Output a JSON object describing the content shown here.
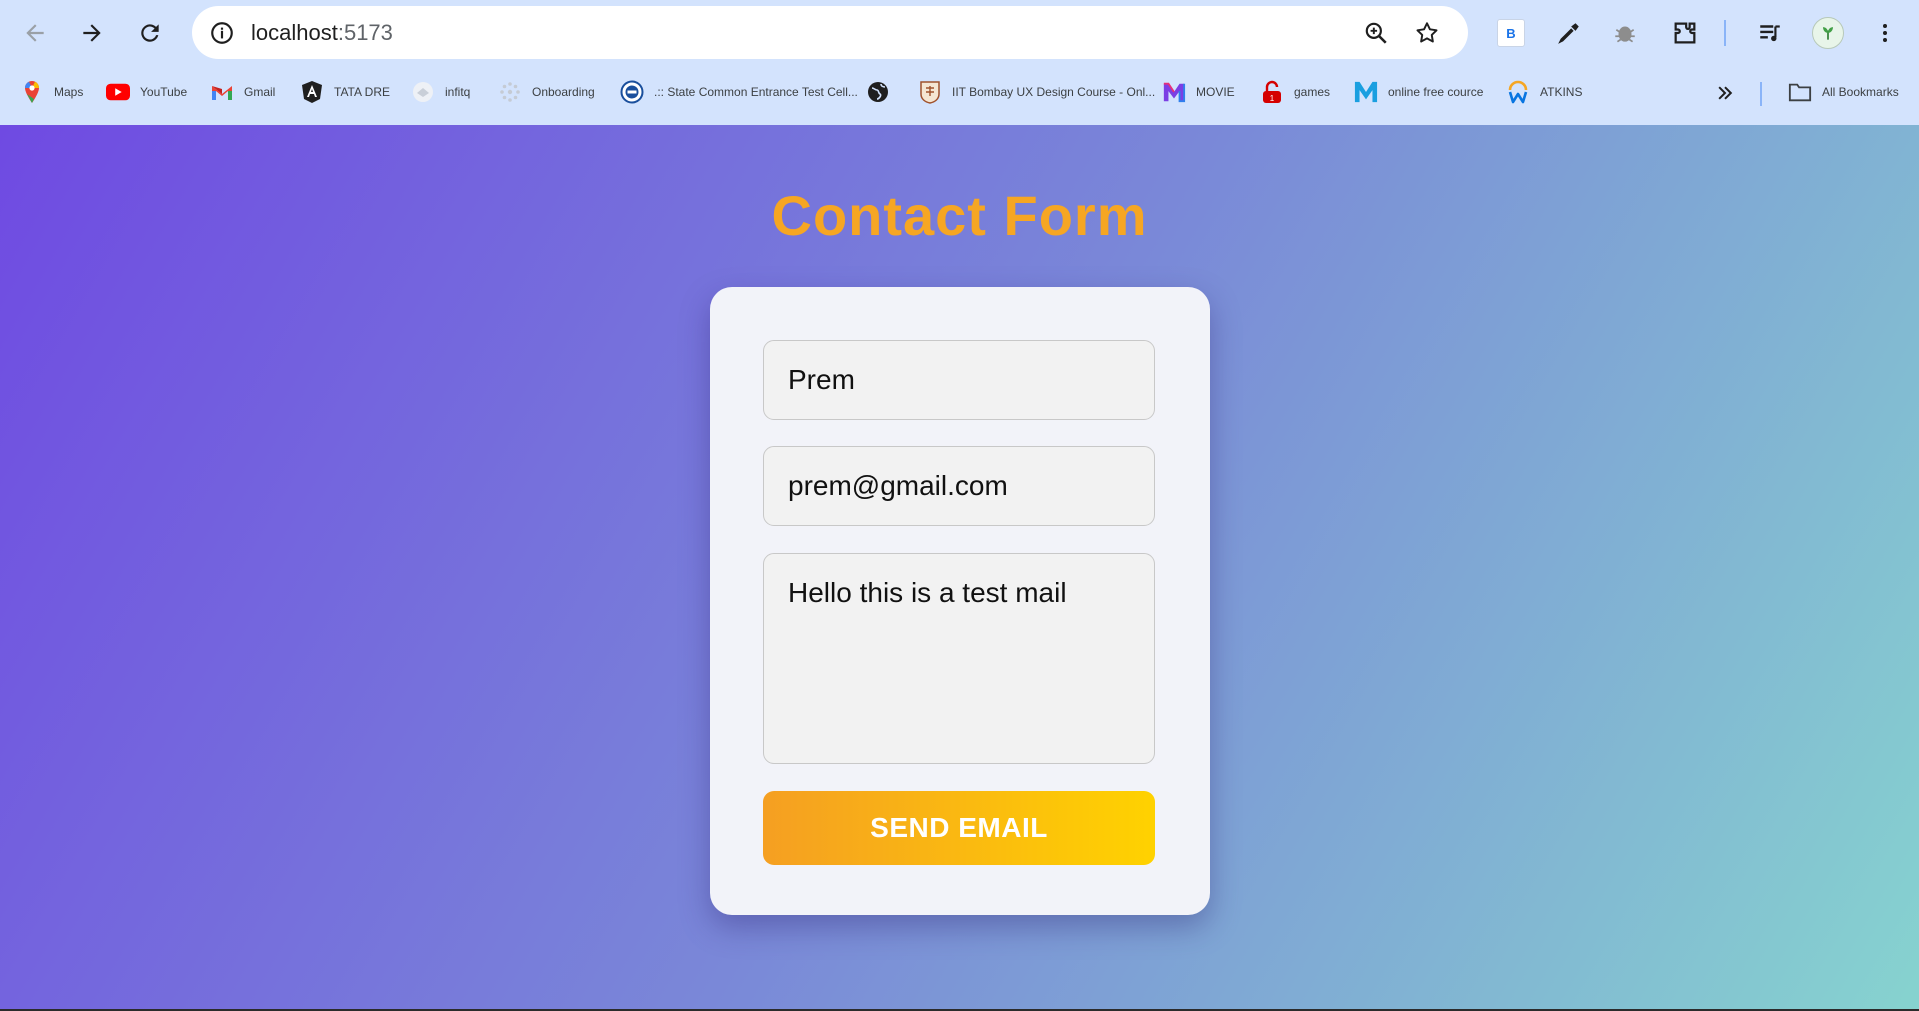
{
  "browser": {
    "url_host": "localhost",
    "url_port": ":5173",
    "bookmarks": [
      {
        "label": "Maps",
        "icon": "maps-icon"
      },
      {
        "label": "YouTube",
        "icon": "youtube-icon"
      },
      {
        "label": "Gmail",
        "icon": "gmail-icon"
      },
      {
        "label": "TATA DRE",
        "icon": "angular-icon"
      },
      {
        "label": "infitq",
        "icon": "infitq-icon"
      },
      {
        "label": "Onboarding",
        "icon": "onboarding-icon"
      },
      {
        "label": ".:: State Common Entrance Test Cell...",
        "icon": "cet-icon"
      },
      {
        "label": "",
        "icon": "globe-icon"
      },
      {
        "label": "IIT Bombay UX Design Course - Onl...",
        "icon": "iit-icon"
      },
      {
        "label": "MOVIE",
        "icon": "movie-icon"
      },
      {
        "label": "games",
        "icon": "games-icon"
      },
      {
        "label": "online free cource",
        "icon": "m-icon"
      },
      {
        "label": "ATKINS",
        "icon": "workday-icon"
      }
    ],
    "all_bookmarks": "All Bookmarks",
    "extension_b": "B"
  },
  "page": {
    "title": "Contact Form",
    "form": {
      "name_value": "Prem",
      "email_value": "prem@gmail.com",
      "message_value": "Hello this is a test mail",
      "submit_label": "SEND EMAIL"
    }
  },
  "colors": {
    "chrome_bg": "#d3e3fd",
    "title": "#f6a623",
    "button_start": "#f59f22",
    "button_end": "#ffd200",
    "gradient_start": "#6f4ae2",
    "gradient_end": "#86d3cf"
  }
}
